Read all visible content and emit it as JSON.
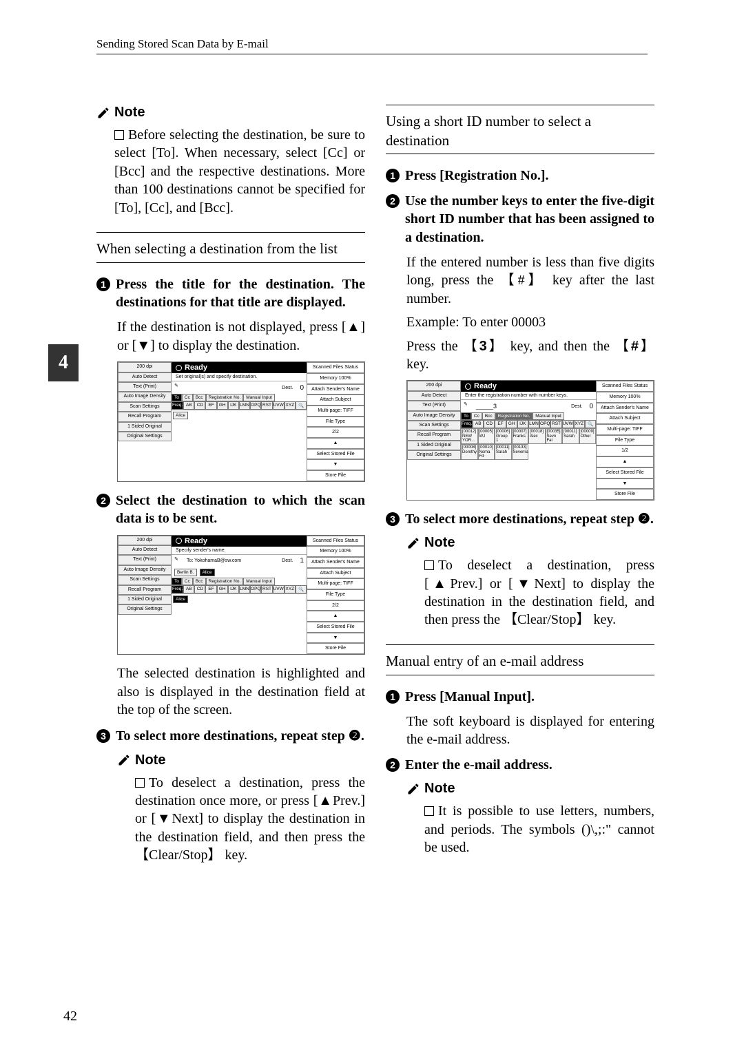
{
  "running_head": "Sending Stored Scan Data by E-mail",
  "side_tab": "4",
  "page_number": "42",
  "labels": {
    "note": "Note",
    "key_hash": "#",
    "key_3": "3",
    "key_clear_stop": "Clear/Stop",
    "prev": "▲Prev.",
    "next": "▼Next",
    "up": "▲",
    "down": "▼",
    "to": "To",
    "cc": "Cc",
    "bcc": "Bcc",
    "reg_no": "Registration No.",
    "manual_input": "Manual Input"
  },
  "left": {
    "note1_para": "Before selecting the destination, be sure to select [To]. When necessary, select [Cc] or [Bcc] and the respective destinations. More than 100 destinations cannot be specified for [To], [Cc], and [Bcc].",
    "subhead1": "When selecting a destination from the list",
    "step1": "Press the title for the destination. The destinations for that title are displayed.",
    "step1_sub": "If the destination is not displayed, press [▲] or [▼] to display the destination.",
    "step2": "Select the destination to which the scan data is to be sent.",
    "para2": "The selected destination is highlighted and also is displayed in the destination field at the top of the screen.",
    "step3": "To select more destinations, repeat step ❷.",
    "note2_para": "To deselect a destination, press the destination once more, or press [▲Prev.] or [▼Next] to display the destination in the destination field, and then press the 【Clear/Stop】 key."
  },
  "right": {
    "subhead1": "Using a short ID number to select a destination",
    "step1": "Press [Registration No.].",
    "step2": "Use the number keys to enter the five-digit short ID number that has been assigned to a destination.",
    "step2_sub1": "If the entered number is less than five digits long, press the 【#】 key after the last number.",
    "step2_sub2": "Example: To enter 00003",
    "step2_sub3_a": "Press the ",
    "step2_sub3_b": " key, and then the ",
    "step2_sub3_c": " key.",
    "step3": "To select more destinations, repeat step ❷.",
    "note1_para": "To deselect a destination, press [▲Prev.] or [▼Next] to display the destination in the destination field, and then press the 【Clear/Stop】 key.",
    "subhead2": "Manual entry of an e-mail address",
    "step_m1": "Press [Manual Input].",
    "step_m1_sub": "The soft keyboard is displayed for entering the e-mail address.",
    "step_m2": "Enter the e-mail address.",
    "note2_para": "It is possible to use letters, numbers, and periods. The symbols ()\\,;:\" cannot be used."
  },
  "shot": {
    "ready": "Ready",
    "sub1": "Set original(s) and specify destination.",
    "sub2": "Specify sender's name.",
    "sub3": "Enter the registration number with number keys.",
    "dest_label": "Dest.",
    "dest0": "0",
    "dest1": "1",
    "entered": "_____3",
    "to_example": "To:    YokohamaB@sw.com",
    "chip1": "Berlin B.",
    "chip2": "Alice",
    "scanned_status": "Scanned Files Status",
    "memory": "Memory 100%",
    "attach_sender": "Attach Sender's Name",
    "attach_subject": "Attach Subject",
    "multi_tiff": "Multi-page: TIFF",
    "file_type": "File Type",
    "select_stored": "Select Stored File",
    "store_file": "Store File",
    "half": "1/2",
    "twotwo": "2/2",
    "left_cells": [
      "200 dpi",
      "Auto Detect",
      "Text (Print)",
      "Auto Image Density",
      "Scan Settings",
      "Recall Program",
      "1 Sided Original",
      "Original Settings"
    ],
    "tabs": [
      "To",
      "Cc",
      "Bcc",
      "",
      "Registration No.",
      "Manual Input"
    ],
    "letters": [
      "Freq.",
      "AB",
      "CD",
      "EF",
      "GH",
      "IJK",
      "LMN",
      "OPQ",
      "RST",
      "UVW",
      "XYZ",
      "🔍"
    ],
    "dest_cells": [
      "[00011]\nSarah",
      "[00009]\nOther",
      "[00008]\nDorothy",
      "[00010]\nNoma Fd",
      "[00011]\nSarah",
      "[00133]\nSeverna",
      "[00012]\nNEW YOR…",
      "[00005]\nWJ",
      "[00006]\nGroup 1",
      "[00007]\nFranks",
      "[00018]\nAlec",
      "[00035]\nSevn Fai"
    ]
  }
}
